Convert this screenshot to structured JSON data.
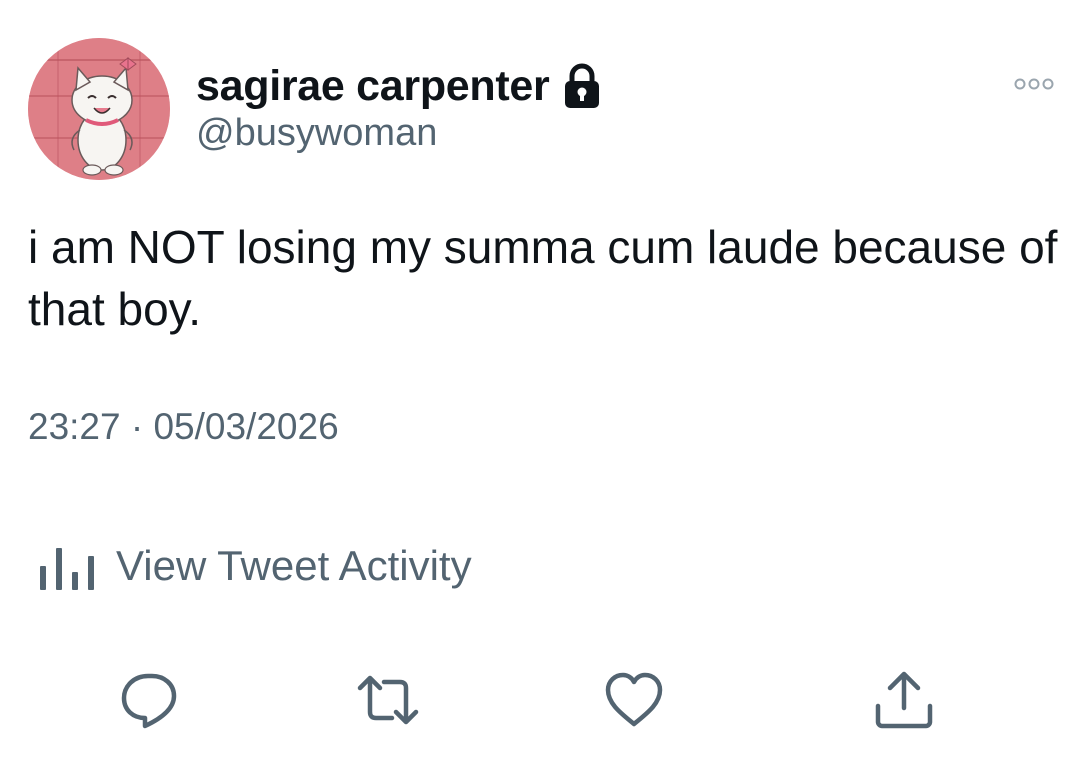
{
  "author": {
    "display_name": "sagirae carpenter",
    "handle": "@busywoman",
    "protected": true
  },
  "tweet": {
    "text": "i am NOT losing my summa cum laude because of that boy.",
    "timestamp": "23:27 · 05/03/2026"
  },
  "activity": {
    "label": "View Tweet Activity"
  },
  "icons": {
    "lock": "lock-icon",
    "more": "more-icon",
    "activity": "bar-chart-icon",
    "reply": "reply-icon",
    "retweet": "retweet-icon",
    "like": "heart-icon",
    "share": "share-icon"
  },
  "colors": {
    "text_primary": "#0f1419",
    "text_secondary": "#536471",
    "background": "#ffffff"
  }
}
